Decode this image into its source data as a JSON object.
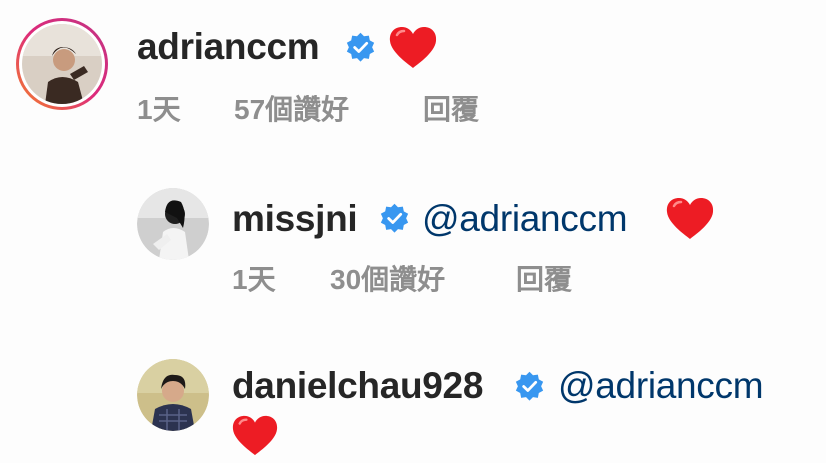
{
  "comments": [
    {
      "username": "adrianccm",
      "verified": true,
      "mention": "",
      "time": "1天",
      "likes": "57個讚好",
      "reply": "回覆",
      "icons": [
        "profile-photo",
        "verified-badge-icon",
        "red-heart-icon"
      ]
    },
    {
      "username": "missjni",
      "verified": true,
      "mention": "@adrianccm",
      "time": "1天",
      "likes": "30個讚好",
      "reply": "回覆",
      "icons": [
        "profile-photo",
        "verified-badge-icon",
        "red-heart-icon"
      ]
    },
    {
      "username": "danielchau928",
      "verified": true,
      "mention": "@adrianccm",
      "icons": [
        "profile-photo",
        "verified-badge-icon",
        "red-heart-icon"
      ]
    }
  ],
  "colors": {
    "verified_blue": "#3897f0",
    "heart_red": "#ed4956",
    "mention_blue": "#00376b",
    "meta_gray": "#8e8e8e",
    "story_ring_start": "#f58529",
    "story_ring_end": "#dd2a7b"
  }
}
